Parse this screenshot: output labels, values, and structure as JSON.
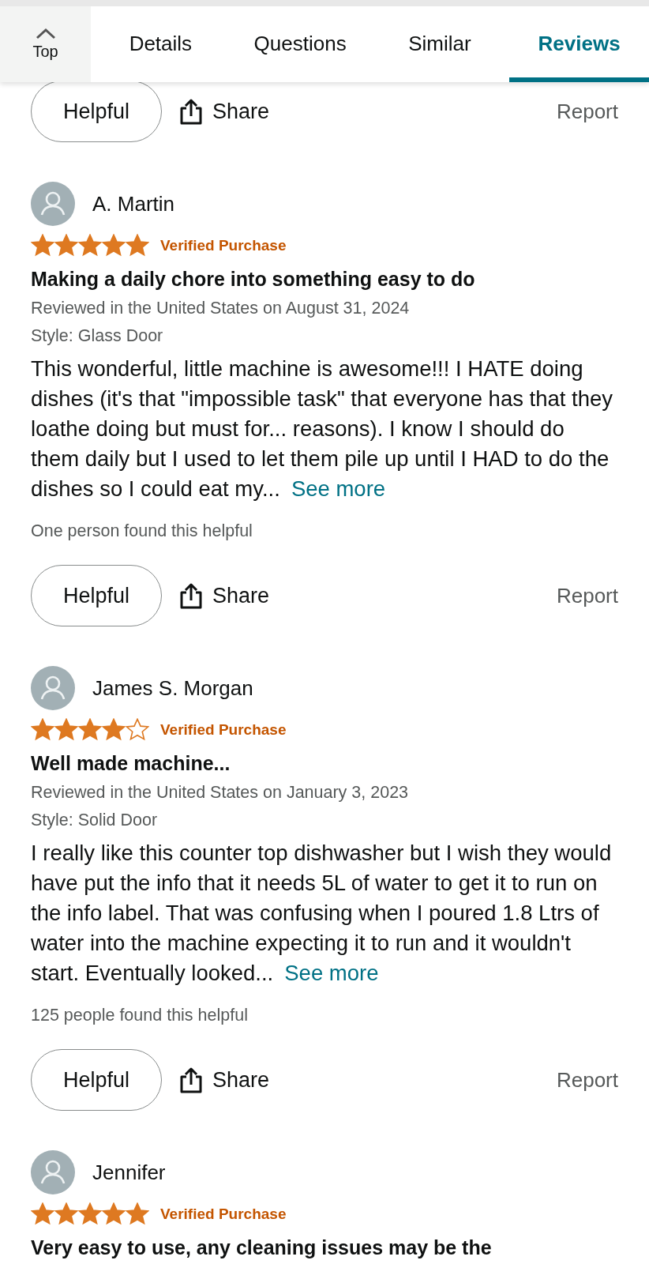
{
  "top_button": {
    "label": "Top"
  },
  "tabs": [
    {
      "label": "Details",
      "selected": false
    },
    {
      "label": "Questions",
      "selected": false
    },
    {
      "label": "Similar",
      "selected": false
    },
    {
      "label": "Reviews",
      "selected": true
    }
  ],
  "feed": [
    {
      "kind": "actions",
      "helpful": "Helpful",
      "share": "Share",
      "report": "Report"
    },
    {
      "kind": "review",
      "name": "A. Martin",
      "stars": 5,
      "badge": "Verified Purchase",
      "title": "Making a daily chore into something easy to do",
      "date": "Reviewed in the United States on August 31, 2024",
      "style": "Style: Glass Door",
      "body": "This wonderful, little machine is awesome!!! I HATE doing dishes (it's that \"impossible task\" that everyone has that they loathe doing but must for... reasons). I know I should do them daily but I used to let them pile up until I HAD to do the dishes so I could eat my...",
      "see_more": "See more",
      "helpful_count": "One person found this helpful"
    },
    {
      "kind": "actions",
      "helpful": "Helpful",
      "share": "Share",
      "report": "Report"
    },
    {
      "kind": "review",
      "name": "James S. Morgan",
      "stars": 4,
      "badge": "Verified Purchase",
      "title": "Well made machine...",
      "date": "Reviewed in the United States on January 3, 2023",
      "style": "Style: Solid Door",
      "body": "I really like this counter top dishwasher but I wish they would have put the info that it needs 5L of water to get it to run on the info label. That was confusing when I poured 1.8 Ltrs of water into the machine expecting it to run and it wouldn't start. Eventually looked...",
      "see_more": "See more",
      "helpful_count": "125 people found this helpful"
    },
    {
      "kind": "actions",
      "helpful": "Helpful",
      "share": "Share",
      "report": "Report"
    },
    {
      "kind": "review",
      "name": "Jennifer",
      "stars": 5,
      "badge": "Verified Purchase",
      "title": "Very easy to use, any cleaning issues may be the"
    }
  ]
}
